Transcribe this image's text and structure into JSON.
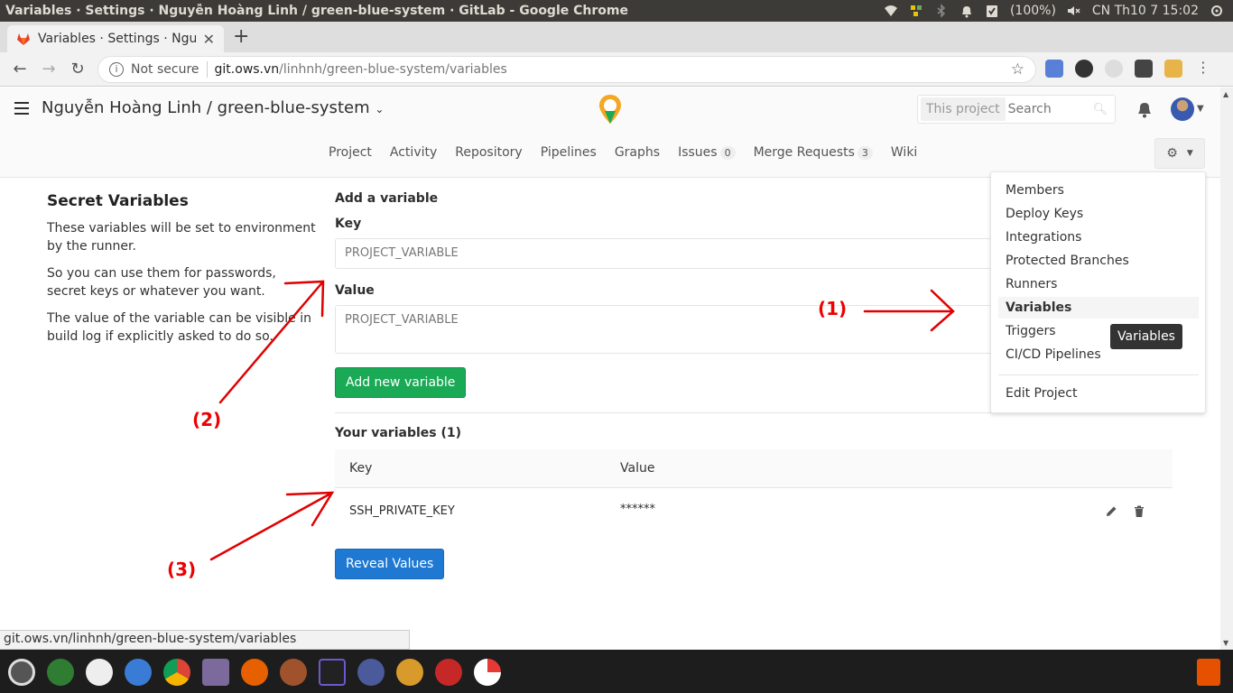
{
  "os": {
    "window_title": "Variables · Settings · Nguyễn Hoàng Linh / green-blue-system · GitLab - Google Chrome",
    "battery": "(100%)",
    "clock": "CN Th10  7 15:02"
  },
  "browser": {
    "tab_title": "Variables · Settings · Nguyễn",
    "not_secure": "Not secure",
    "url_host": "git.ows.vn",
    "url_path": "/linhnh/green-blue-system/variables",
    "status_url": "git.ows.vn/linhnh/green-blue-system/variables"
  },
  "header": {
    "project_title": "Nguyễn Hoàng Linh / green-blue-system",
    "search_scope": "This project",
    "search_placeholder": "Search"
  },
  "subnav": {
    "items": [
      {
        "label": "Project"
      },
      {
        "label": "Activity"
      },
      {
        "label": "Repository"
      },
      {
        "label": "Pipelines"
      },
      {
        "label": "Graphs"
      },
      {
        "label": "Issues",
        "count": "0"
      },
      {
        "label": "Merge Requests",
        "count": "3"
      },
      {
        "label": "Wiki"
      }
    ]
  },
  "sidebar_text": {
    "heading": "Secret Variables",
    "p1": "These variables will be set to environment by the runner.",
    "p2": "So you can use them for passwords, secret keys or whatever you want.",
    "p3": "The value of the variable can be visible in build log if explicitly asked to do so."
  },
  "form": {
    "title": "Add a variable",
    "key_label": "Key",
    "key_placeholder": "PROJECT_VARIABLE",
    "value_label": "Value",
    "value_placeholder": "PROJECT_VARIABLE",
    "add_button": "Add new variable"
  },
  "variables": {
    "title": "Your variables (1)",
    "col_key": "Key",
    "col_value": "Value",
    "rows": [
      {
        "key": "SSH_PRIVATE_KEY",
        "value": "******"
      }
    ],
    "reveal_button": "Reveal Values"
  },
  "settings_menu": {
    "items": [
      "Members",
      "Deploy Keys",
      "Integrations",
      "Protected Branches",
      "Runners",
      "Variables",
      "Triggers",
      "CI/CD Pipelines"
    ],
    "active": "Variables",
    "edit_project": "Edit Project",
    "tooltip": "Variables"
  },
  "annotations": [
    "(1)",
    "(2)",
    "(3)"
  ],
  "colors": {
    "green_button": "#1aaa55",
    "blue_button": "#1f78d1",
    "annotation_red": "#e00000"
  }
}
